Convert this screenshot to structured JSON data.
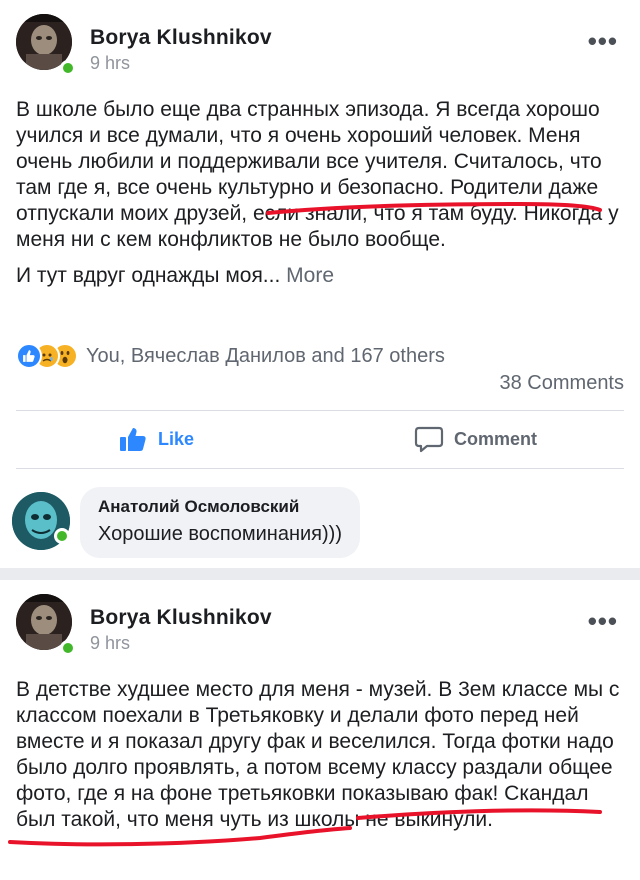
{
  "posts": [
    {
      "author": "Borya Klushnikov",
      "time": "9 hrs",
      "more": "•••",
      "paragraph1": "В школе было еще два странных эпизода. Я всегда хорошо учился и все думали, что я очень хороший человек. Меня очень любили и поддерживали все учителя. Считалось, что там где я, все очень культурно и безопасно. Родители даже отпускали моих друзей, если знали, что я там буду. Никогда у меня ни с кем конфликтов не было вообще.",
      "paragraph2": "И тут вдруг однажды моя... ",
      "see_more": "More",
      "reactors": "You, Вячеслав Данилов and 167 others",
      "comments_count": "38 Comments",
      "like_label": "Like",
      "comment_label": "Comment",
      "comment": {
        "name": "Анатолий Осмоловский",
        "text": "Хорошие воспоминания)))"
      }
    },
    {
      "author": "Borya Klushnikov",
      "time": "9 hrs",
      "more": "•••",
      "paragraph1": "В детстве худшее место для меня - музей. В 3ем классе мы с классом поехали в Третьяковку и делали фото перед ней вместе и я показал другу фак и веселился. Тогда фотки надо было долго проявлять, а потом всему классу раздали общее фото, где я на фоне третьяковки показываю фак! Скандал был такой, что меня чуть из школы не выкинули."
    }
  ],
  "colors": {
    "online": "#42b72a",
    "like_blue": "#2d88ff",
    "underline_red": "#e8132a",
    "separator": "#e9ebee"
  },
  "icons": [
    "like-reaction-icon",
    "sad-reaction-icon",
    "wow-reaction-icon",
    "thumbs-up-icon",
    "comment-icon",
    "more-options-icon"
  ]
}
